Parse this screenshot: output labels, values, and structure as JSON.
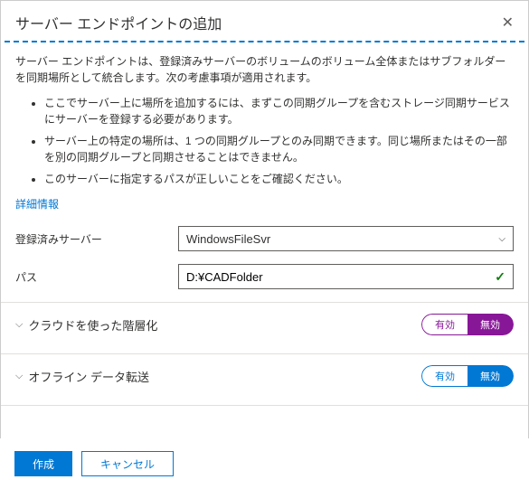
{
  "header": {
    "title": "サーバー エンドポイントの追加"
  },
  "intro": "サーバー エンドポイントは、登録済みサーバーのボリュームのボリューム全体またはサブフォルダーを同期場所として統合します。次の考慮事項が適用されます。",
  "bullets": [
    "ここでサーバー上に場所を追加するには、まずこの同期グループを含むストレージ同期サービスにサーバーを登録する必要があります。",
    "サーバー上の特定の場所は、1 つの同期グループとのみ同期できます。同じ場所またはその一部を別の同期グループと同期させることはできません。",
    "このサーバーに指定するパスが正しいことをご確認ください。"
  ],
  "link": "詳細情報",
  "fields": {
    "server_label": "登録済みサーバー",
    "server_value": "WindowsFileSvr",
    "path_label": "パス",
    "path_value": "D:¥CADFolder"
  },
  "sections": {
    "tiering": {
      "title": "クラウドを使った階層化",
      "on": "有効",
      "off": "無効"
    },
    "offline": {
      "title": "オフライン データ転送",
      "on": "有効",
      "off": "無効"
    }
  },
  "footer": {
    "create": "作成",
    "cancel": "キャンセル"
  }
}
